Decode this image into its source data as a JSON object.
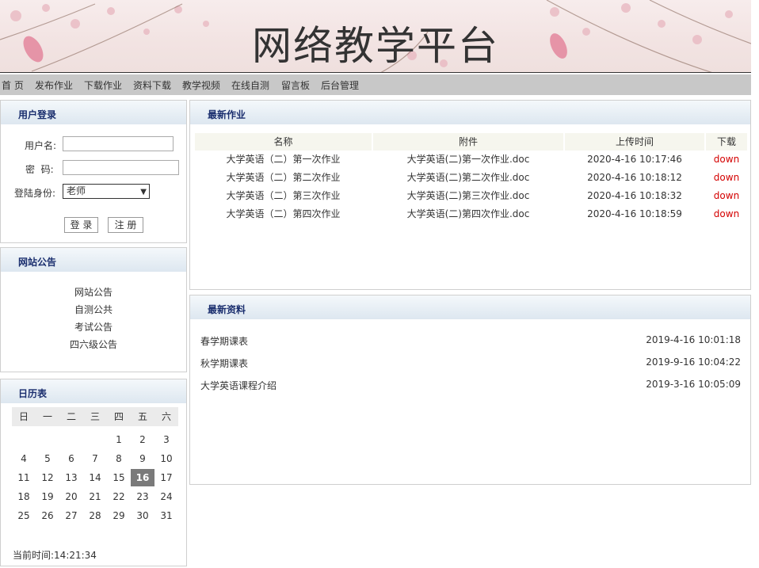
{
  "header": {
    "title": "网络教学平台"
  },
  "nav": {
    "items": [
      "首 页",
      "发布作业",
      "下载作业",
      "资料下载",
      "教学视频",
      "在线自测",
      "留言板",
      "后台管理"
    ]
  },
  "login": {
    "title": "用户登录",
    "username_label": "用户名:",
    "password_label": "密  码:",
    "role_label": "登陆身份:",
    "role_value": "老师",
    "login_button": "登 录",
    "register_button": "注 册"
  },
  "notice": {
    "title": "网站公告",
    "items": [
      "网站公告",
      "自测公共",
      "考试公告",
      "四六级公告"
    ]
  },
  "calendar": {
    "title": "日历表",
    "weekdays": [
      "日",
      "一",
      "二",
      "三",
      "四",
      "五",
      "六"
    ],
    "weeks": [
      [
        "",
        "",
        "",
        "",
        "1",
        "2",
        "3"
      ],
      [
        "4",
        "5",
        "6",
        "7",
        "8",
        "9",
        "10"
      ],
      [
        "11",
        "12",
        "13",
        "14",
        "15",
        "16",
        "17"
      ],
      [
        "18",
        "19",
        "20",
        "21",
        "22",
        "23",
        "24"
      ],
      [
        "25",
        "26",
        "27",
        "28",
        "29",
        "30",
        "31"
      ]
    ],
    "today": "16",
    "current_time": "当前时间:14:21:34"
  },
  "homework": {
    "title": "最新作业",
    "columns": [
      "名称",
      "附件",
      "上传时间",
      "下载"
    ],
    "rows": [
      {
        "name": "大学英语（二）第一次作业",
        "file": "大学英语(二)第一次作业.doc",
        "time": "2020-4-16 10:17:46",
        "download": "down"
      },
      {
        "name": "大学英语（二）第二次作业",
        "file": "大学英语(二)第二次作业.doc",
        "time": "2020-4-16 10:18:12",
        "download": "down"
      },
      {
        "name": "大学英语（二）第三次作业",
        "file": "大学英语(二)第三次作业.doc",
        "time": "2020-4-16 10:18:32",
        "download": "down"
      },
      {
        "name": "大学英语（二）第四次作业",
        "file": "大学英语(二)第四次作业.doc",
        "time": "2020-4-16 10:18:59",
        "download": "down"
      }
    ]
  },
  "resources": {
    "title": "最新资料",
    "items": [
      {
        "name": "春学期课表",
        "time": "2019-4-16 10:01:18"
      },
      {
        "name": "秋学期课表",
        "time": "2019-9-16 10:04:22"
      },
      {
        "name": "大学英语课程介绍",
        "time": "2019-3-16 10:05:09"
      }
    ]
  },
  "colors": {
    "panel_title": "#1a2e6e",
    "download_link": "#d40000",
    "nav_bg": "#c8c8c8",
    "today_bg": "#7a7a7a"
  }
}
